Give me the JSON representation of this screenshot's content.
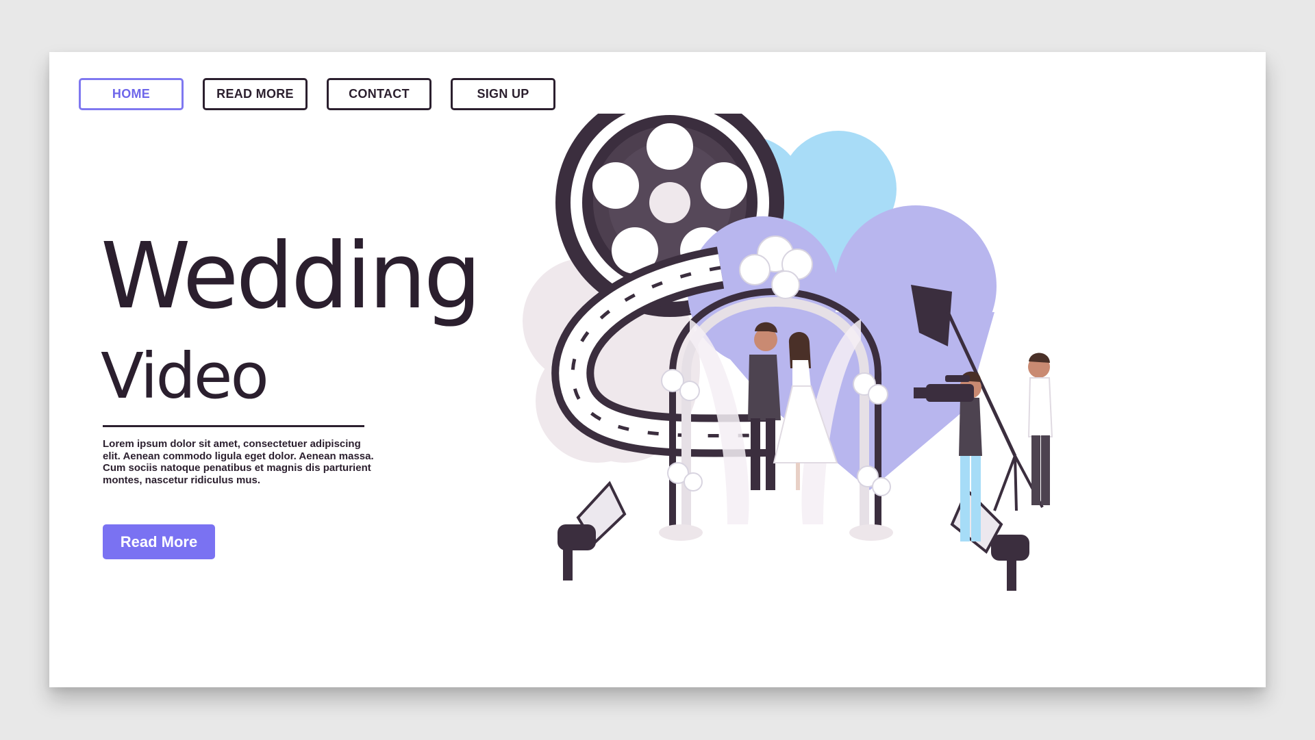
{
  "nav": {
    "items": [
      {
        "label": "HOME"
      },
      {
        "label": "READ MORE"
      },
      {
        "label": "CONTACT"
      },
      {
        "label": "SIGN UP"
      }
    ]
  },
  "hero": {
    "title": "Wedding",
    "subtitle": "Video",
    "body": "Lorem ipsum dolor sit amet, consectetuer adipiscing elit. Aenean commodo ligula eget dolor. Aenean massa. Cum sociis natoque penatibus et magnis dis parturient montes, nascetur ridiculus mus.",
    "cta_label": "Read More"
  },
  "colors": {
    "accent": "#7a72f2",
    "dark": "#2b1f2e",
    "heart_blue": "#a6dcf8",
    "heart_lavender": "#b7b5ef",
    "blob_pink": "#ede4e8"
  }
}
